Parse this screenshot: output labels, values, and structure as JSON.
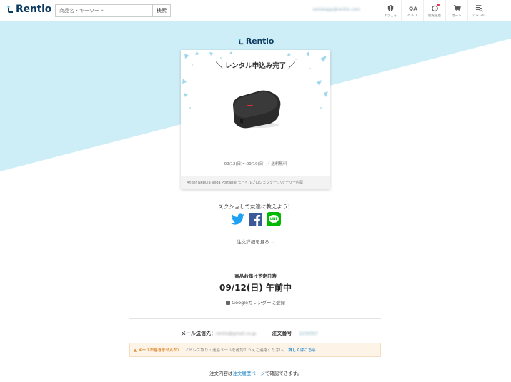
{
  "header": {
    "logo": "Rentio",
    "search_placeholder": "商品名・キーワード",
    "search_button": "検索",
    "user_email": "rentalapp@rentio.com",
    "nav": [
      {
        "label": "ようこそ",
        "icon": "shield-icon"
      },
      {
        "label": "ヘルプ",
        "icon": "qa-icon"
      },
      {
        "label": "閲覧履歴",
        "icon": "history-icon"
      },
      {
        "label": "カート",
        "icon": "cart-icon"
      },
      {
        "label": "ジャンル",
        "icon": "genre-icon"
      }
    ]
  },
  "brand": {
    "logo": "Rentio"
  },
  "card": {
    "title": "＼ レンタル申込み完了 ／",
    "dates": "09/12(日)〜09/19(日) ／ 送料無料",
    "product_name": "Anker Nebula Vega Portable モバイルプロジェクター(バッテリー内蔵)"
  },
  "share": {
    "text": "スクショして友達に教えよう！"
  },
  "order_detail_link": "注文詳細を見る",
  "delivery": {
    "label": "商品お届け予定日時",
    "date": "09/12(日) 午前中",
    "calendar_link": "Googleカレンダーに登録"
  },
  "mail": {
    "label": "メール送信先：",
    "address": "rentio@gmail.co.jp",
    "order_label": "注文番号",
    "order_number": "1234567"
  },
  "notice": {
    "warning": "メールが届きませんか？",
    "description": "アドレス誤り・迷惑メールを確認のうえご連絡ください。",
    "link": "詳しくはこちら"
  },
  "history": {
    "prefix": "注文内容は",
    "link": "注文履歴ページ",
    "suffix": "で確認できます。"
  },
  "colors": {
    "accent": "#2c8fd0",
    "background_blue": "#cdeef7",
    "logo_navy": "#0b3a61",
    "warning_orange": "#e0872e"
  }
}
